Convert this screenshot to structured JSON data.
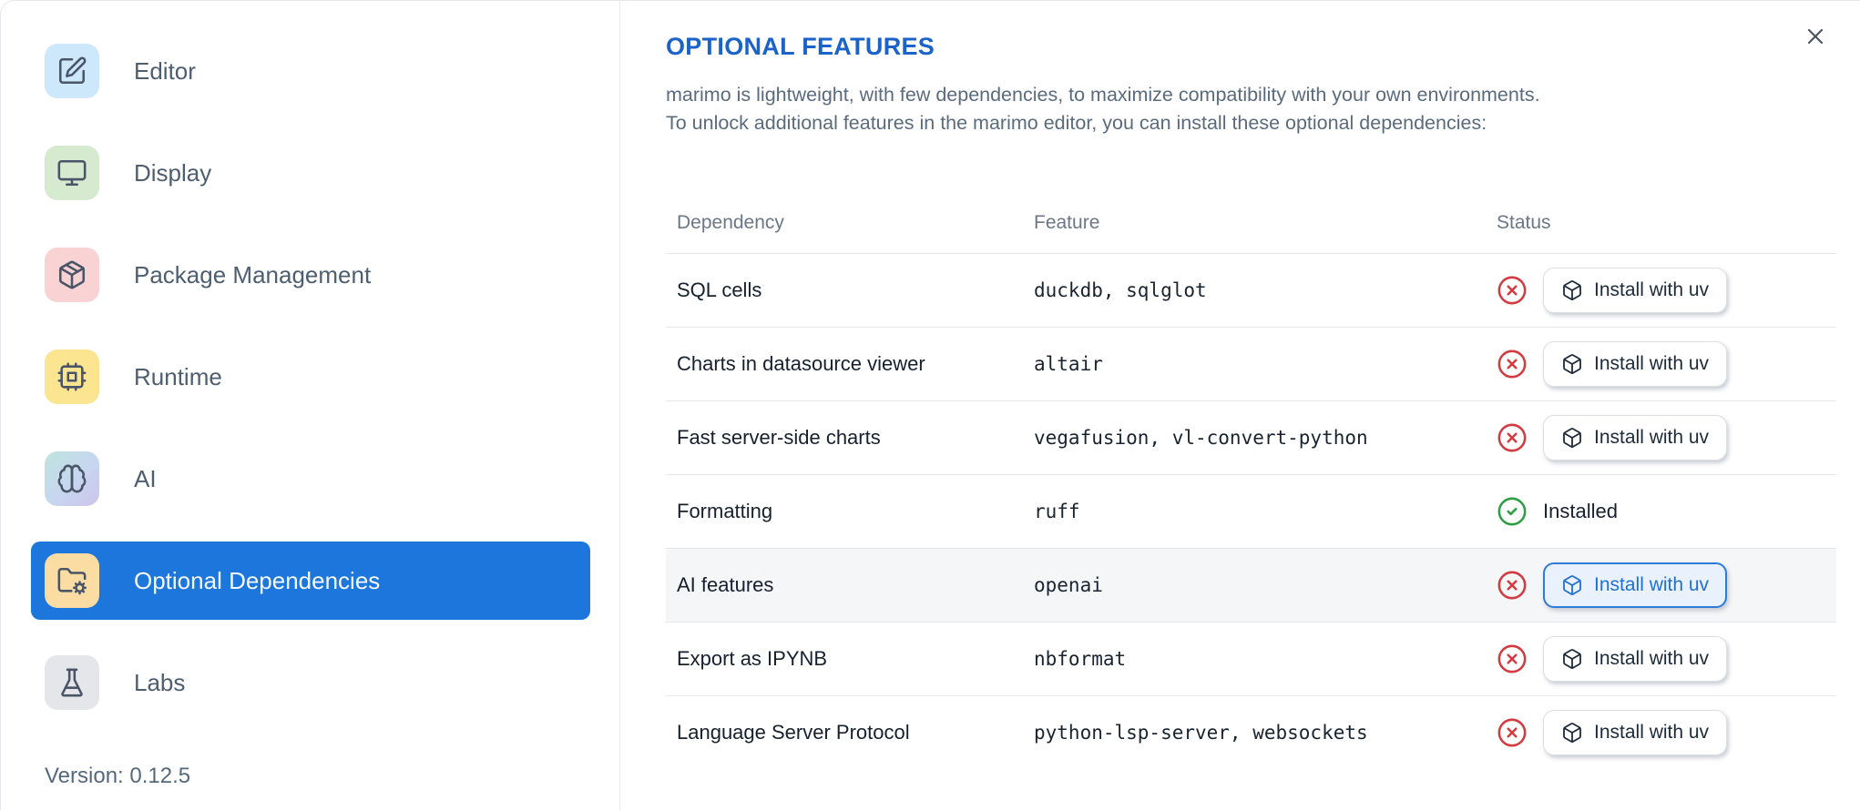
{
  "sidebar": {
    "items": [
      {
        "label": "Editor",
        "icon": "square-pen-icon"
      },
      {
        "label": "Display",
        "icon": "monitor-icon"
      },
      {
        "label": "Package Management",
        "icon": "package-icon"
      },
      {
        "label": "Runtime",
        "icon": "cpu-icon"
      },
      {
        "label": "AI",
        "icon": "brain-icon"
      },
      {
        "label": "Optional Dependencies",
        "icon": "folder-cog-icon",
        "selected": true
      },
      {
        "label": "Labs",
        "icon": "flask-icon"
      }
    ],
    "version": "Version: 0.12.5"
  },
  "main": {
    "title": "OPTIONAL FEATURES",
    "description_lines": [
      "marimo is lightweight, with few dependencies, to maximize compatibility with your own environments.",
      "To unlock additional features in the marimo editor, you can install these optional dependencies:"
    ],
    "close_icon": "x-icon",
    "table": {
      "headers": [
        "Dependency",
        "Feature",
        "Status"
      ],
      "rows": [
        {
          "dependency": "SQL cells",
          "feature": "duckdb, sqlglot",
          "status": "not-installed",
          "status_icon": "circle-x-icon",
          "action_label": "Install with uv",
          "button_icon": "box-icon"
        },
        {
          "dependency": "Charts in datasource viewer",
          "feature": "altair",
          "status": "not-installed",
          "status_icon": "circle-x-icon",
          "action_label": "Install with uv",
          "button_icon": "box-icon"
        },
        {
          "dependency": "Fast server-side charts",
          "feature": "vegafusion, vl-convert-python",
          "status": "not-installed",
          "status_icon": "circle-x-icon",
          "action_label": "Install with uv",
          "button_icon": "box-icon"
        },
        {
          "dependency": "Formatting",
          "feature": "ruff",
          "status": "installed",
          "status_icon": "circle-check-icon",
          "status_label": "Installed"
        },
        {
          "dependency": "AI features",
          "feature": "openai",
          "status": "not-installed",
          "status_icon": "circle-x-icon",
          "action_label": "Install with uv",
          "button_icon": "box-icon",
          "highlighted": true
        },
        {
          "dependency": "Export as IPYNB",
          "feature": "nbformat",
          "status": "not-installed",
          "status_icon": "circle-x-icon",
          "action_label": "Install with uv",
          "button_icon": "box-icon"
        },
        {
          "dependency": "Language Server Protocol",
          "feature": "python-lsp-server, websockets",
          "status": "not-installed",
          "status_icon": "circle-x-icon",
          "action_label": "Install with uv",
          "button_icon": "box-icon"
        }
      ]
    }
  },
  "colors": {
    "selected_item_blue": "#1C76DB",
    "title_blue": "#1A63C9",
    "error_red": "#D33B40",
    "success_green": "#2E9E45",
    "highlight_button_blue": "#1F70D4"
  }
}
